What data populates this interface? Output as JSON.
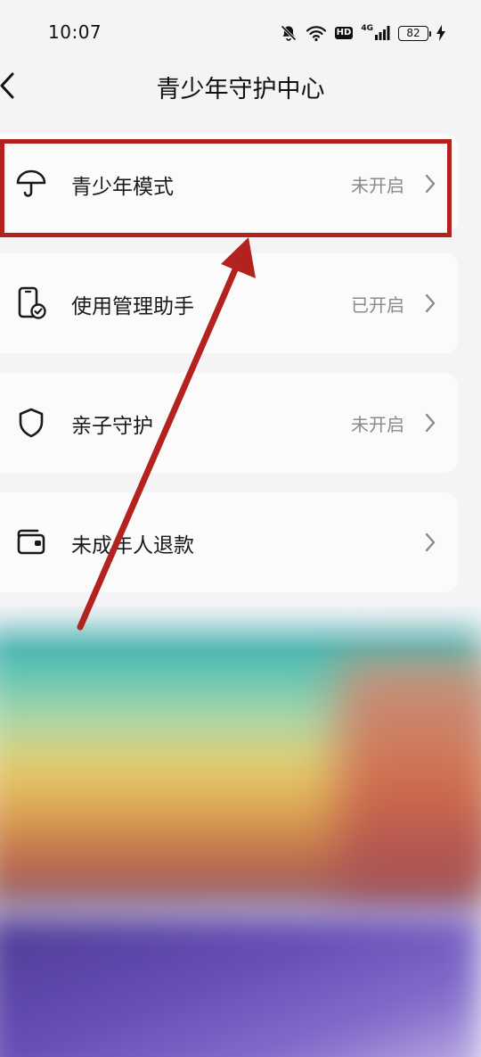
{
  "status_bar": {
    "time": "10:07",
    "network_label": "4G",
    "hd_label": "HD",
    "battery_level": "82"
  },
  "nav": {
    "title": "青少年守护中心"
  },
  "menu": {
    "items": [
      {
        "label": "青少年模式",
        "status": "未开启",
        "icon": "umbrella-icon"
      },
      {
        "label": "使用管理助手",
        "status": "已开启",
        "icon": "phone-check-icon"
      },
      {
        "label": "亲子守护",
        "status": "未开启",
        "icon": "shield-icon"
      },
      {
        "label": "未成年人退款",
        "status": "",
        "icon": "wallet-icon"
      }
    ]
  },
  "colors": {
    "highlight": "#b3221f",
    "annotation_arrow": "#b3221f",
    "status_text": "#8a8a8e",
    "card_background": "#fbfbfc",
    "page_background": "#f4f4f6"
  }
}
